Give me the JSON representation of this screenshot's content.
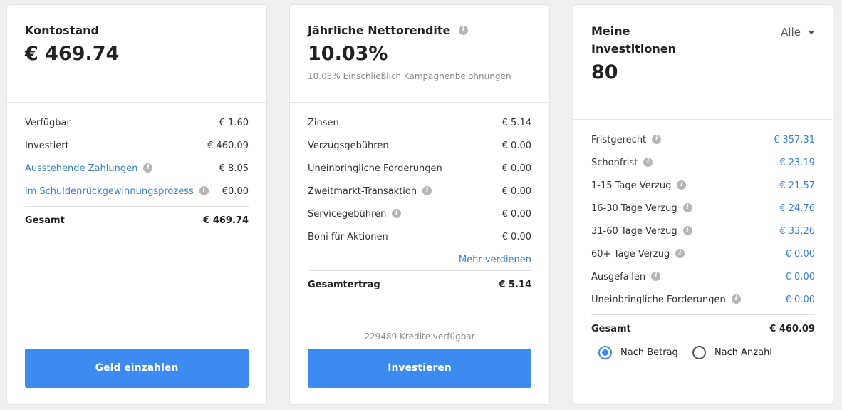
{
  "account": {
    "title": "Kontostand",
    "balance": "€ 469.74",
    "rows": [
      {
        "label": "Verfügbar",
        "value": "€ 1.60"
      },
      {
        "label": "Investiert",
        "value": "€ 460.09"
      },
      {
        "label": "Ausstehende Zahlungen",
        "value": "€ 8.05"
      },
      {
        "label": "im Schuldenrückgewinnungsprozess",
        "value": "€0.00"
      }
    ],
    "total_label": "Gesamt",
    "total_value": "€ 469.74",
    "button": "Geld einzahlen"
  },
  "returns": {
    "title": "Jährliche Nettorendite",
    "value": "10.03%",
    "subtitle": "10.03% Einschließlich Kampagnenbelohnungen",
    "rows": [
      {
        "label": "Zinsen",
        "value": "€ 5.14"
      },
      {
        "label": "Verzugsgebühren",
        "value": "€ 0.00"
      },
      {
        "label": "Uneinbringliche Forderungen",
        "value": "€ 0.00"
      },
      {
        "label": "Zweitmarkt-Transaktion",
        "value": "€ 0.00"
      },
      {
        "label": "Servicegebühren",
        "value": "€ 0.00"
      },
      {
        "label": "Boni für Aktionen",
        "value": "€ 0.00"
      }
    ],
    "more_link": "Mehr verdienen",
    "total_label": "Gesamtertrag",
    "total_value": "€ 5.14",
    "credits": "229489 Kredite verfügbar",
    "button": "Investieren"
  },
  "investments": {
    "title": "Meine Investitionen",
    "count": "80",
    "filter": "Alle",
    "rows": [
      {
        "label": "Fristgerecht",
        "value": "€ 357.31"
      },
      {
        "label": "Schonfrist",
        "value": "€ 23.19"
      },
      {
        "label": "1-15 Tage Verzug",
        "value": "€ 21.57"
      },
      {
        "label": "16-30 Tage Verzug",
        "value": "€ 24.76"
      },
      {
        "label": "31-60 Tage Verzug",
        "value": "€ 33.26"
      },
      {
        "label": "60+ Tage Verzug",
        "value": "€ 0.00"
      },
      {
        "label": "Ausgefallen",
        "value": "€ 0.00"
      },
      {
        "label": "Uneinbringliche Forderungen",
        "value": "€ 0.00"
      }
    ],
    "total_label": "Gesamt",
    "total_value": "€ 460.09",
    "radio_by_amount": "Nach Betrag",
    "radio_by_count": "Nach Anzahl",
    "selected": "Nach Betrag"
  },
  "colors": {
    "accent": "#3d8af1",
    "link": "#3a7fd5"
  }
}
